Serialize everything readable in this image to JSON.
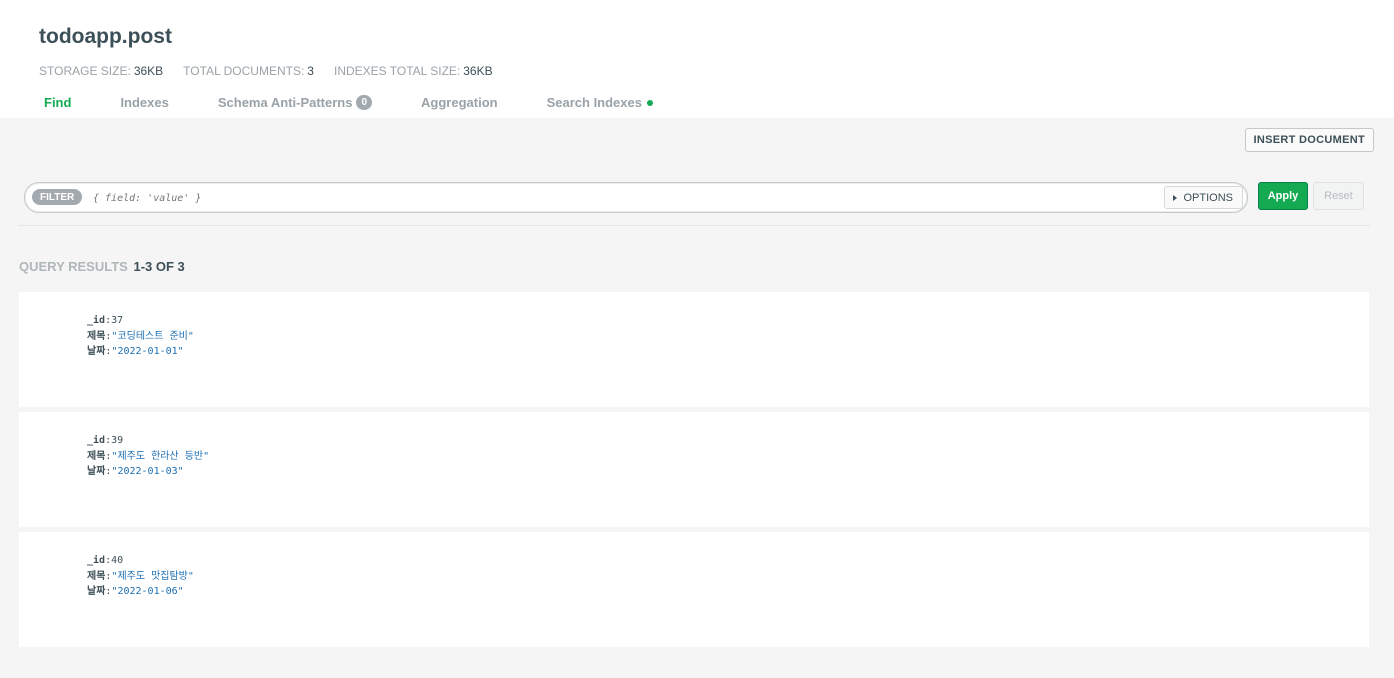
{
  "collection": {
    "title": "todoapp.post",
    "stats": [
      {
        "label": "STORAGE SIZE:",
        "value": "36KB"
      },
      {
        "label": "TOTAL DOCUMENTS:",
        "value": "3"
      },
      {
        "label": "INDEXES TOTAL SIZE:",
        "value": "36KB"
      }
    ]
  },
  "tabs": [
    {
      "label": "Find",
      "active": true
    },
    {
      "label": "Indexes"
    },
    {
      "label": "Schema Anti-Patterns",
      "badge": "0"
    },
    {
      "label": "Aggregation"
    },
    {
      "label": "Search Indexes",
      "status": "green-dot"
    }
  ],
  "toolbar": {
    "insert_label": "INSERT DOCUMENT"
  },
  "filter": {
    "pill": "FILTER",
    "placeholder": "{ field: 'value' }",
    "options_label": "OPTIONS",
    "apply_label": "Apply",
    "reset_label": "Reset"
  },
  "results": {
    "label": "QUERY RESULTS",
    "count": "1-3 OF 3"
  },
  "documents": [
    {
      "id_key": "_id",
      "id_val": "37",
      "title_key": "제목",
      "title_val": "\"코딩테스트 준비\"",
      "date_key": "날짜",
      "date_val": "\"2022-01-01\""
    },
    {
      "id_key": "_id",
      "id_val": "39",
      "title_key": "제목",
      "title_val": "\"제주도 한라산 등반\"",
      "date_key": "날짜",
      "date_val": "\"2022-01-03\""
    },
    {
      "id_key": "_id",
      "id_val": "40",
      "title_key": "제목",
      "title_val": "\"제주도 맛집탐방\"",
      "date_key": "날짜",
      "date_val": "\"2022-01-06\""
    }
  ],
  "colors": {
    "accent": "#13aa52",
    "string_value": "#1c6eb4",
    "muted": "#9aa2a7"
  }
}
